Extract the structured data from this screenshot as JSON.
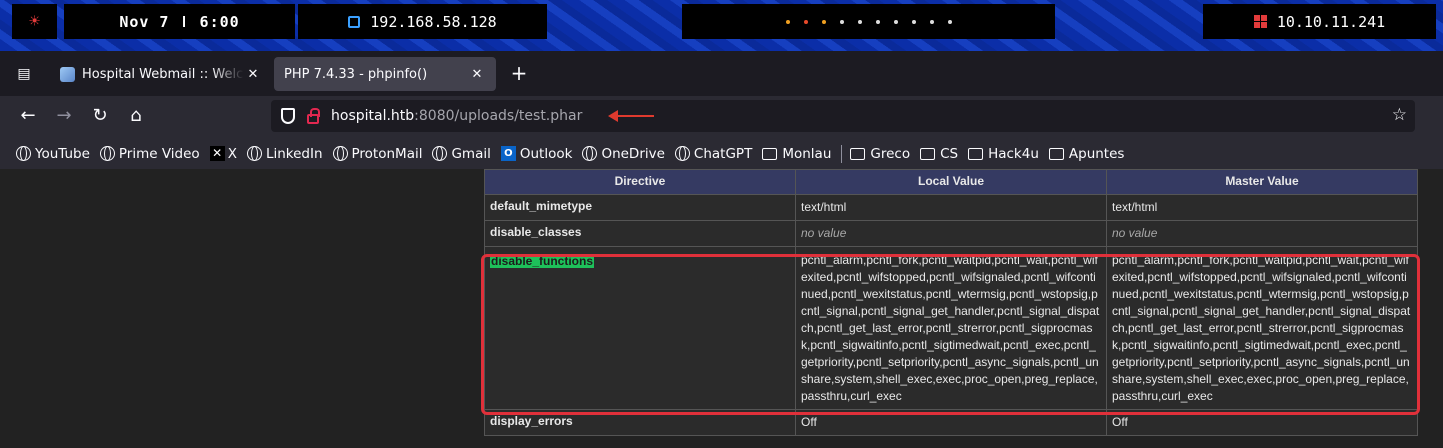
{
  "system_bar": {
    "datetime": "Nov 7 ǀ 6:00",
    "local_ip": "192.168.58.128",
    "target_ip": "10.10.11.241",
    "icons": [
      "fingerprint-icon",
      "monitor-icon",
      "windows-icon"
    ],
    "dot_colors": [
      "#f0a020",
      "#e84a2a",
      "#f0a020",
      "#dddddd",
      "#dddddd",
      "#dddddd",
      "#dddddd",
      "#dddddd",
      "#dddddd",
      "#dddddd"
    ]
  },
  "browser": {
    "tabs": [
      {
        "title": "Hospital Webmail :: Welcome",
        "active": false
      },
      {
        "title": "PHP 7.4.33 - phpinfo()",
        "active": true
      }
    ],
    "url": {
      "host": "hospital.htb",
      "rest": ":8080/uploads/test.phar"
    },
    "bookmarks": [
      {
        "label": "YouTube",
        "icon": "globe-icon"
      },
      {
        "label": "Prime Video",
        "icon": "globe-icon"
      },
      {
        "label": "X",
        "icon": "x-logo-icon"
      },
      {
        "label": "LinkedIn",
        "icon": "globe-icon"
      },
      {
        "label": "ProtonMail",
        "icon": "globe-icon"
      },
      {
        "label": "Gmail",
        "icon": "globe-icon"
      },
      {
        "label": "Outlook",
        "icon": "outlook-icon"
      },
      {
        "label": "OneDrive",
        "icon": "globe-icon"
      },
      {
        "label": "ChatGPT",
        "icon": "globe-icon"
      },
      {
        "label": "Monlau",
        "icon": "folder-icon"
      },
      {
        "label": "Greco",
        "icon": "folder-icon"
      },
      {
        "label": "CS",
        "icon": "folder-icon"
      },
      {
        "label": "Hack4u",
        "icon": "folder-icon"
      },
      {
        "label": "Apuntes",
        "icon": "folder-icon"
      }
    ]
  },
  "phpinfo": {
    "headers": [
      "Directive",
      "Local Value",
      "Master Value"
    ],
    "rows": [
      {
        "directive": "default_mimetype",
        "local": "text/html",
        "master": "text/html"
      },
      {
        "directive": "disable_classes",
        "local": "no value",
        "master": "no value"
      },
      {
        "directive": "disable_functions",
        "local": "pcntl_alarm,pcntl_fork,pcntl_waitpid,pcntl_wait,pcntl_wifexited,pcntl_wifstopped,pcntl_wifsignaled,pcntl_wifcontinued,pcntl_wexitstatus,pcntl_wtermsig,pcntl_wstopsig,pcntl_signal,pcntl_signal_get_handler,pcntl_signal_dispatch,pcntl_get_last_error,pcntl_strerror,pcntl_sigprocmask,pcntl_sigwaitinfo,pcntl_sigtimedwait,pcntl_exec,pcntl_getpriority,pcntl_setpriority,pcntl_async_signals,pcntl_unshare,system,shell_exec,exec,proc_open,preg_replace,passthru,curl_exec",
        "master": "pcntl_alarm,pcntl_fork,pcntl_waitpid,pcntl_wait,pcntl_wifexited,pcntl_wifstopped,pcntl_wifsignaled,pcntl_wifcontinued,pcntl_wexitstatus,pcntl_wtermsig,pcntl_wstopsig,pcntl_signal,pcntl_signal_get_handler,pcntl_signal_dispatch,pcntl_get_last_error,pcntl_strerror,pcntl_sigprocmask,pcntl_sigwaitinfo,pcntl_sigtimedwait,pcntl_exec,pcntl_getpriority,pcntl_setpriority,pcntl_async_signals,pcntl_unshare,system,shell_exec,exec,proc_open,preg_replace,passthru,curl_exec",
        "highlighted": true
      },
      {
        "directive": "display_errors",
        "local": "Off",
        "master": "Off"
      }
    ]
  },
  "annotation_colors": {
    "highlight": "#1ec05a",
    "box": "#e0303a",
    "arrow": "#e03a2e"
  }
}
